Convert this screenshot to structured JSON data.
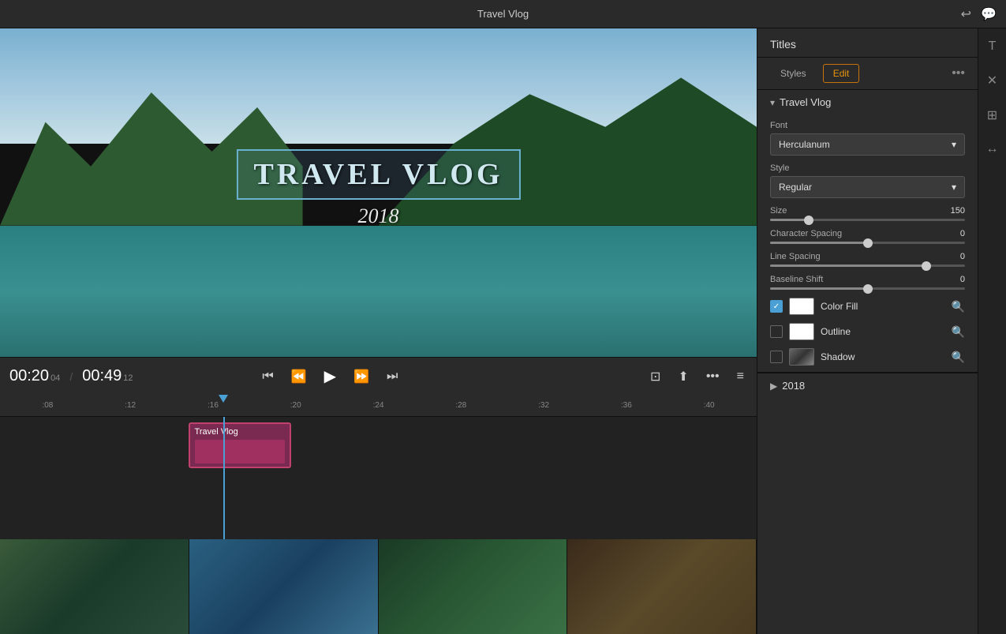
{
  "app": {
    "title": "Travel Vlog"
  },
  "topbar": {
    "title": "Travel Vlog",
    "undo_icon": "↩",
    "chat_icon": "💬"
  },
  "preview": {
    "title_text": "TRAVEL VLOG",
    "subtitle_text": "2018"
  },
  "playback": {
    "current_time": "00:20",
    "current_frames": "04",
    "total_time": "00:49",
    "total_frames": "12",
    "progress_percent": 38
  },
  "timeline": {
    "ruler_marks": [
      ":08",
      ":12",
      ":16",
      ":20",
      ":24",
      ":28",
      ":32",
      ":36",
      ":40"
    ],
    "clip_label": "Travel Vlog"
  },
  "titles_panel": {
    "header": "Titles",
    "tabs": {
      "styles_label": "Styles",
      "edit_label": "Edit"
    },
    "more_icon": "•••",
    "section_travel_vlog": {
      "name": "Travel Vlog",
      "chevron": "▾"
    },
    "font": {
      "label": "Font",
      "value": "Herculanum"
    },
    "style": {
      "label": "Style",
      "value": "Regular"
    },
    "size": {
      "label": "Size",
      "value": "150",
      "thumb_percent": 20
    },
    "character_spacing": {
      "label": "Character Spacing",
      "value": "0",
      "thumb_percent": 50
    },
    "line_spacing": {
      "label": "Line Spacing",
      "value": "0",
      "thumb_percent": 80
    },
    "baseline_shift": {
      "label": "Baseline Shift",
      "value": "0",
      "thumb_percent": 50
    },
    "color_fill": {
      "label": "Color Fill",
      "checked": true,
      "color": "#ffffff"
    },
    "outline": {
      "label": "Outline",
      "checked": false,
      "color": "#ffffff"
    },
    "shadow": {
      "label": "Shadow",
      "checked": false
    },
    "section_2018": {
      "name": "2018",
      "chevron": "▶"
    }
  },
  "sidebar_icons": [
    "T",
    "✕",
    "⊞",
    "↔"
  ]
}
